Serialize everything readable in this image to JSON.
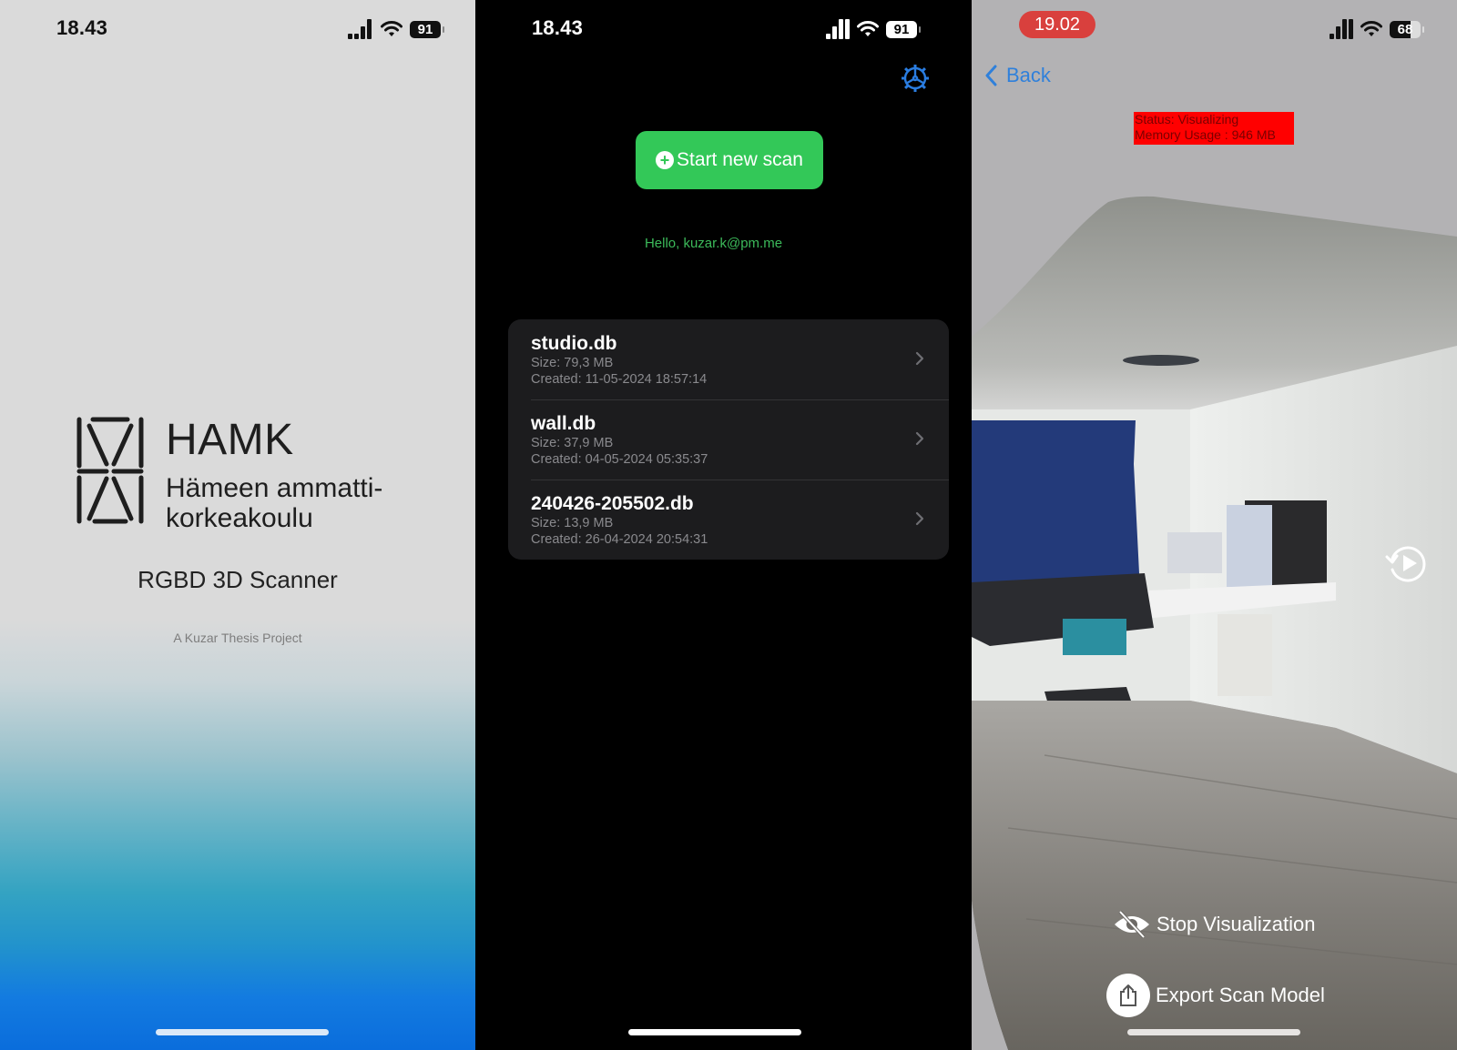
{
  "splash_screen": {
    "status_bar": {
      "time": "18.43",
      "battery": "91"
    },
    "brand": {
      "name": "HAMK",
      "subtitle_line1": "Hämeen ammatti-",
      "subtitle_line2": "korkeakoulu"
    },
    "app_title": "RGBD 3D Scanner",
    "credit": "A Kuzar Thesis Project"
  },
  "home_screen": {
    "status_bar": {
      "time": "18.43",
      "battery": "91"
    },
    "settings_icon": "gear-icon",
    "start_button_label": "Start new scan",
    "greeting": "Hello, kuzar.k@pm.me",
    "files": [
      {
        "name": "studio.db",
        "size": "Size: 79,3 MB",
        "created": "Created: 11-05-2024 18:57:14"
      },
      {
        "name": "wall.db",
        "size": "Size: 37,9 MB",
        "created": "Created: 04-05-2024 05:35:37"
      },
      {
        "name": "240426-205502.db",
        "size": "Size: 13,9 MB",
        "created": "Created: 26-04-2024 20:54:31"
      }
    ]
  },
  "viewer_screen": {
    "status_bar": {
      "time": "19.02",
      "battery": "68",
      "recording": true
    },
    "back_label": "Back",
    "status_line": "Status: Visualizing",
    "memory_line": "Memory Usage : 946 MB",
    "stop_label": "Stop Visualization",
    "export_label": "Export Scan Model"
  },
  "colors": {
    "accent_green": "#33c858",
    "link_blue": "#2f80db",
    "status_red": "#ff0000",
    "recording_red": "#d9403d"
  }
}
